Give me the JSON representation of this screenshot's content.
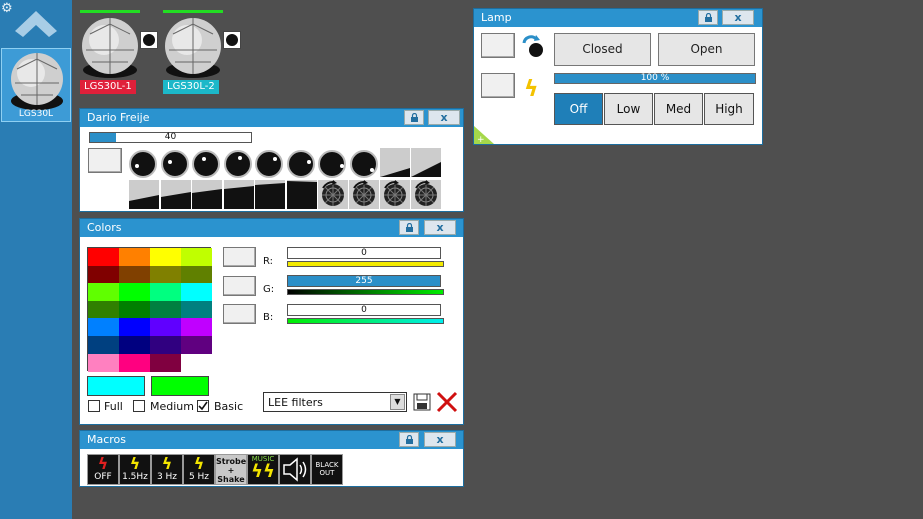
{
  "sidebar": {
    "gear_icon": "gear-icon",
    "up_icon": "chevron-up-icon",
    "device_label": "LGS30L"
  },
  "devices": [
    {
      "label": "LGS30L-1",
      "color": "#e0203a"
    },
    {
      "label": "LGS30L-2",
      "color": "#1cb8c9"
    }
  ],
  "lamp": {
    "title": "Lamp",
    "closed_label": "Closed",
    "open_label": "Open",
    "level_text": "100 %",
    "level_value": 100,
    "modes": [
      "Off",
      "Low",
      "Med",
      "High"
    ],
    "active_mode": "Off"
  },
  "dario": {
    "title": "Dario Freije",
    "value_text": "40",
    "value": 40
  },
  "colors": {
    "title": "Colors",
    "r_label": "R:",
    "g_label": "G:",
    "b_label": "B:",
    "r_value": "0",
    "g_value": "255",
    "b_value": "0",
    "palette": [
      [
        "#ff0000",
        "#ff8000",
        "#ffff00",
        "#c0ff00"
      ],
      [
        "#800000",
        "#804000",
        "#808000",
        "#608000"
      ],
      [
        "#60ff00",
        "#00ff00",
        "#00ff80",
        "#00ffff"
      ],
      [
        "#308000",
        "#008000",
        "#008040",
        "#008080"
      ],
      [
        "#0080ff",
        "#0000ff",
        "#6000ff",
        "#c000ff"
      ],
      [
        "#004080",
        "#000080",
        "#300080",
        "#600080"
      ],
      [
        "#ff80c0",
        "#ff0080",
        "#800040",
        "#ffffff"
      ]
    ],
    "current_color_a": "#00ffff",
    "current_color_b": "#00ff00",
    "opt_full": "Full",
    "opt_medium": "Medium",
    "opt_basic": "Basic",
    "basic_checked": true,
    "filter_value": "LEE filters"
  },
  "macros": {
    "title": "Macros",
    "items": [
      {
        "caption": "OFF"
      },
      {
        "caption": "1.5Hz"
      },
      {
        "caption": "3 Hz"
      },
      {
        "caption": "5 Hz"
      },
      {
        "caption": "Strobe\n+\nShake"
      },
      {
        "caption": "MUSIC"
      },
      {
        "caption": ""
      },
      {
        "caption": "BLACK OUT"
      }
    ]
  }
}
